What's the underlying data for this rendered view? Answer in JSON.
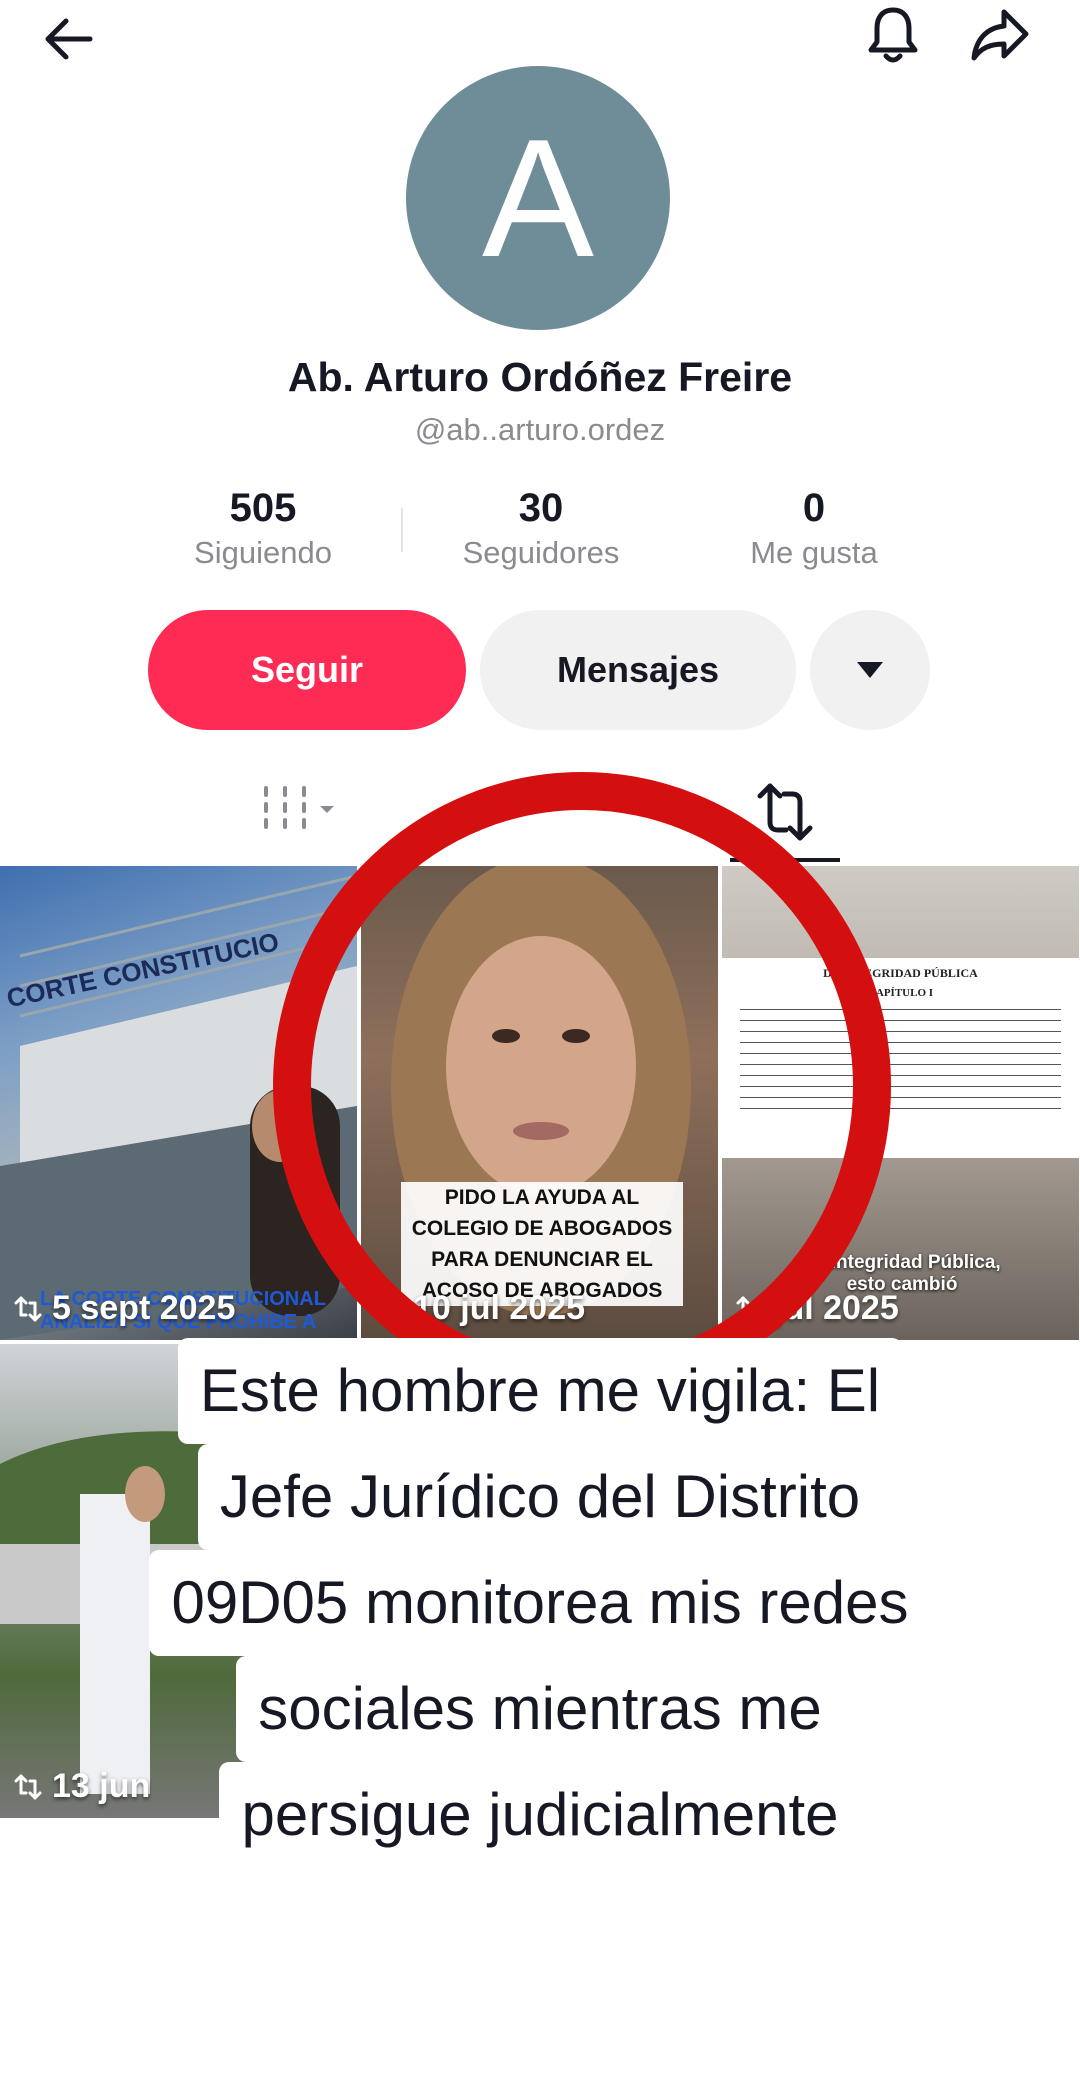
{
  "header": {
    "back_icon": "arrow-left-icon",
    "bell_icon": "bell-icon",
    "share_icon": "share-arrow-icon"
  },
  "profile": {
    "avatar_letter": "A",
    "avatar_color": "#6f8d98",
    "name": "Ab. Arturo Ordóñez Freire",
    "handle": "@ab..arturo.ordez"
  },
  "stats": [
    {
      "value": "505",
      "label": "Siguiendo"
    },
    {
      "value": "30",
      "label": "Seguidores"
    },
    {
      "value": "0",
      "label": "Me gusta"
    }
  ],
  "actions": {
    "follow_label": "Seguir",
    "messages_label": "Mensajes",
    "more_icon": "caret-down-icon",
    "accent_color": "#fe2c55"
  },
  "tabs": {
    "videos_icon": "grid-columns-icon",
    "reposts_icon": "repost-icon",
    "active": "reposts"
  },
  "grid": {
    "tiles": [
      {
        "date": "5 sept 2025",
        "overlay_text": "CORTE CONSTITUCIO",
        "subtitle": "LA CORTE CONSTITUCIONAL ANALIZA SI QUE PROHIBE A"
      },
      {
        "date": "10 jul 2025",
        "caption": "PIDO LA AYUDA AL COLEGIO DE ABOGADOS PARA DENUNCIAR EL ACOSO DE ABOGADOS"
      },
      {
        "date": "jul 2025",
        "doc_title": "DE INTEGRIDAD PÚBLICA",
        "doc_sub": "CAPÍTULO I",
        "subtitle": "Le Integridad Pública, esto cambió"
      },
      {
        "date": "13 jun"
      }
    ]
  },
  "overlay": {
    "lines": [
      "Este hombre me vigila: El",
      "Jefe Jurídico del Distrito",
      "09D05 monitorea mis redes",
      "sociales mientras me",
      "persigue judicialmente"
    ],
    "annotation_color": "#d40f0f"
  }
}
